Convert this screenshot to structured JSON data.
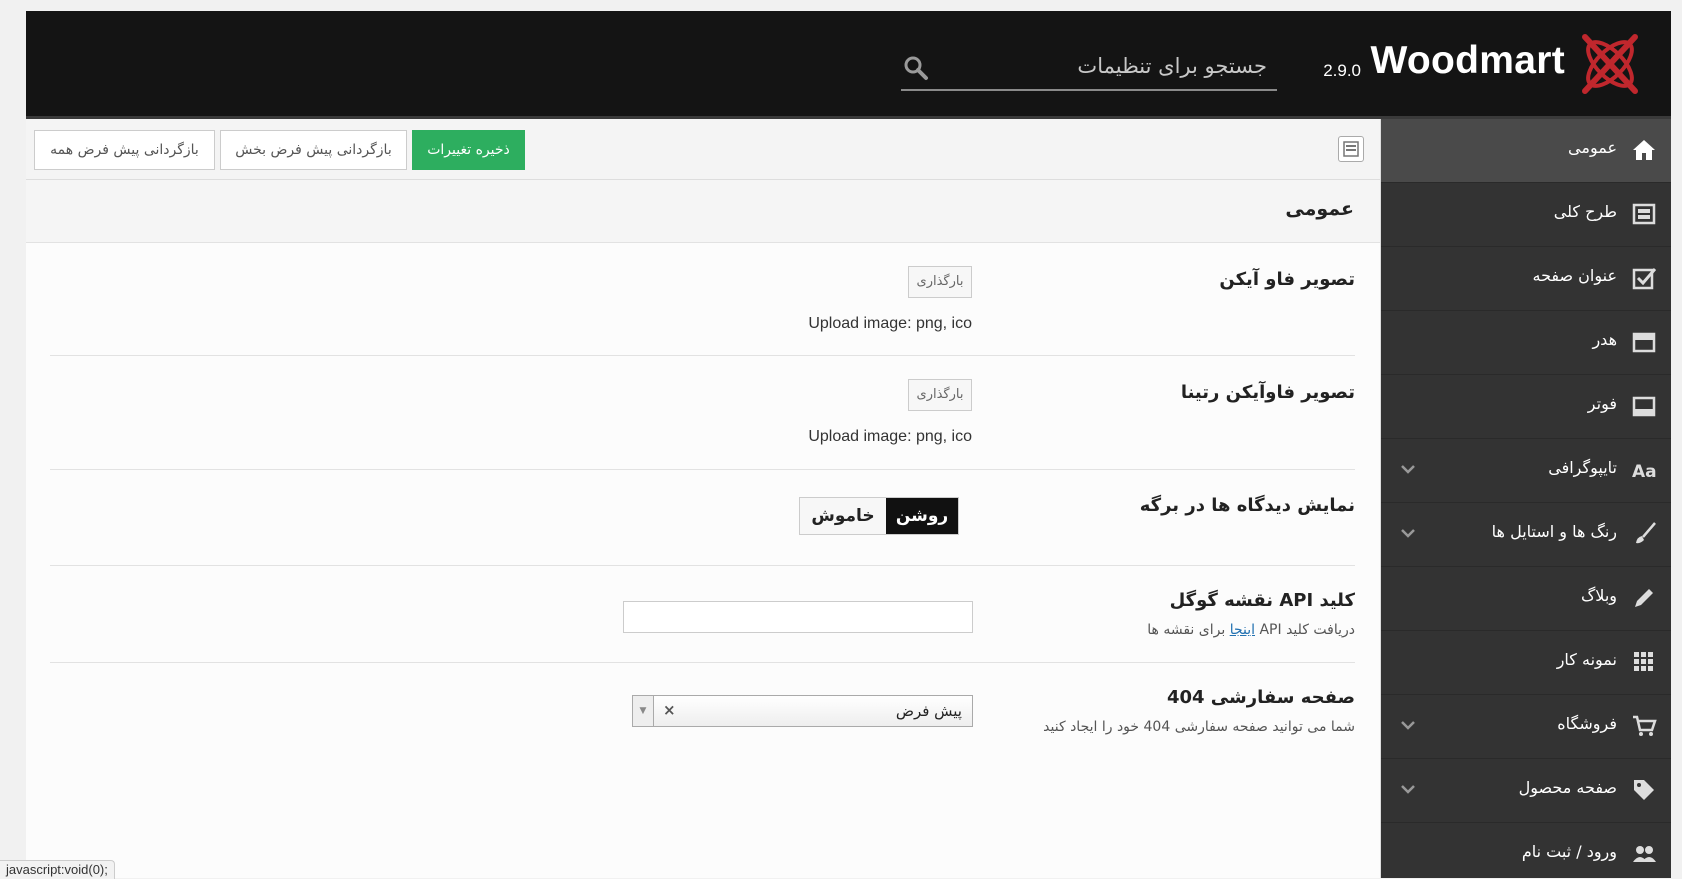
{
  "header": {
    "brand": "Woodmart",
    "version": "2.9.0",
    "search_placeholder": "جستجو برای تنظیمات"
  },
  "toolbar": {
    "save_label": "ذخیره تغییرات",
    "reset_section_label": "بازگردانی پیش فرض بخش",
    "reset_all_label": "بازگردانی پیش فرض همه"
  },
  "section": {
    "title": "عمومی"
  },
  "sidebar": {
    "items": [
      {
        "label": "عمومی",
        "icon": "home-icon",
        "active": true,
        "has_submenu": false
      },
      {
        "label": "طرح کلی",
        "icon": "layout-icon",
        "has_submenu": false
      },
      {
        "label": "عنوان صفحه",
        "icon": "checkbox-icon",
        "has_submenu": false
      },
      {
        "label": "هدر",
        "icon": "header-icon",
        "has_submenu": false
      },
      {
        "label": "فوتر",
        "icon": "footer-icon",
        "has_submenu": false
      },
      {
        "label": "تایپوگرافی",
        "icon": "typography-icon",
        "has_submenu": true
      },
      {
        "label": "رنگ ها و استایل ها",
        "icon": "brush-icon",
        "has_submenu": true
      },
      {
        "label": "وبلاگ",
        "icon": "pencil-icon",
        "has_submenu": false
      },
      {
        "label": "نمونه کار",
        "icon": "grid-icon",
        "has_submenu": false
      },
      {
        "label": "فروشگاه",
        "icon": "cart-icon",
        "has_submenu": true
      },
      {
        "label": "صفحه محصول",
        "icon": "tag-icon",
        "has_submenu": true
      },
      {
        "label": "ورود / ثبت نام",
        "icon": "users-icon",
        "has_submenu": false
      }
    ]
  },
  "fields": {
    "favicon": {
      "title": "تصویر فاو آیکن",
      "upload_label": "بارگذاری",
      "hint": "Upload image: png, ico"
    },
    "favicon_retina": {
      "title": "تصویر فاوآیکن رتینا",
      "upload_label": "بارگذاری",
      "hint": "Upload image: png, ico"
    },
    "comments": {
      "title": "نمایش دیدگاه ها در برگه",
      "on_label": "روشن",
      "off_label": "خاموش",
      "value": "روشن"
    },
    "google_map_api": {
      "title": "کلید API نقشه گوگل",
      "desc_before": "دریافت کلید API ",
      "desc_link": "اینجا",
      "desc_after": " برای نقشه ها",
      "value": ""
    },
    "custom_404": {
      "title": "صفحه سفارشی 404",
      "desc": "شما می توانید صفحه سفارشی 404 خود را ایجاد کنید",
      "value": "پیش فرض",
      "clear": "×"
    }
  },
  "status_bar": "javascript:void(0);",
  "colors": {
    "header_bg": "#141414",
    "sidebar_bg": "#333333",
    "sidebar_active": "#4a4a4a",
    "save_green": "#2dae5f",
    "logo_red": "#c0272d",
    "link_blue": "#2271b1"
  }
}
